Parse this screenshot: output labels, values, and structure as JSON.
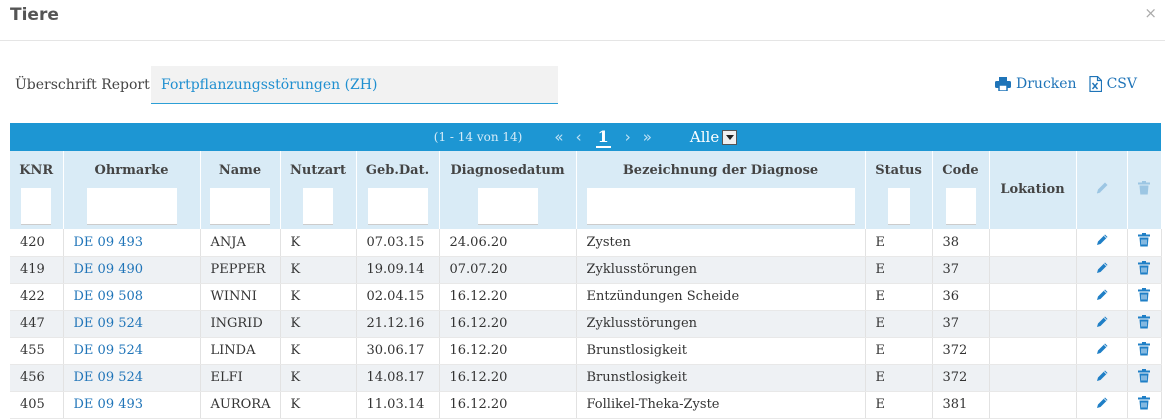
{
  "window": {
    "title": "Tiere",
    "close_glyph": "×"
  },
  "report": {
    "label": "Überschrift Report:",
    "value": "Fortpflanzungsstörungen (ZH)"
  },
  "actions": {
    "print_label": "Drucken",
    "csv_label": "CSV"
  },
  "pager": {
    "range_text": "(1 - 14 von 14)",
    "first_glyph": "«",
    "prev_glyph": "‹",
    "current_page": "1",
    "next_glyph": "›",
    "last_glyph": "»",
    "page_size": "Alle"
  },
  "columns": [
    "KNR",
    "Ohrmarke",
    "Name",
    "Nutzart",
    "Geb.Dat.",
    "Diagnosedatum",
    "Bezeichnung der Diagnose",
    "Status",
    "Code",
    "Lokation"
  ],
  "icons": {
    "edit": "pencil-icon",
    "delete": "trash-icon",
    "print": "printer-icon",
    "csv": "csv-file-icon"
  },
  "colors": {
    "accent": "#1d96d3",
    "link": "#1f74b8",
    "header_bg": "#d9ebf6"
  },
  "rows": [
    {
      "knr": "420",
      "ohrmarke": "DE 09 493",
      "name": "ANJA",
      "nutzart": "K",
      "gebdat": "07.03.15",
      "diagdat": "24.06.20",
      "bezeichnung": "Zysten",
      "status": "E",
      "code": "38",
      "lokation": ""
    },
    {
      "knr": "419",
      "ohrmarke": "DE 09 490",
      "name": "PEPPER",
      "nutzart": "K",
      "gebdat": "19.09.14",
      "diagdat": "07.07.20",
      "bezeichnung": "Zyklusstörungen",
      "status": "E",
      "code": "37",
      "lokation": ""
    },
    {
      "knr": "422",
      "ohrmarke": "DE 09 508",
      "name": "WINNI",
      "nutzart": "K",
      "gebdat": "02.04.15",
      "diagdat": "16.12.20",
      "bezeichnung": "Entzündungen Scheide",
      "status": "E",
      "code": "36",
      "lokation": ""
    },
    {
      "knr": "447",
      "ohrmarke": "DE 09 524",
      "name": "INGRID",
      "nutzart": "K",
      "gebdat": "21.12.16",
      "diagdat": "16.12.20",
      "bezeichnung": "Zyklusstörungen",
      "status": "E",
      "code": "37",
      "lokation": ""
    },
    {
      "knr": "455",
      "ohrmarke": "DE 09 524",
      "name": "LINDA",
      "nutzart": "K",
      "gebdat": "30.06.17",
      "diagdat": "16.12.20",
      "bezeichnung": "Brunstlosigkeit",
      "status": "E",
      "code": "372",
      "lokation": ""
    },
    {
      "knr": "456",
      "ohrmarke": "DE 09 524",
      "name": "ELFI",
      "nutzart": "K",
      "gebdat": "14.08.17",
      "diagdat": "16.12.20",
      "bezeichnung": "Brunstlosigkeit",
      "status": "E",
      "code": "372",
      "lokation": ""
    },
    {
      "knr": "405",
      "ohrmarke": "DE 09 493",
      "name": "AURORA",
      "nutzart": "K",
      "gebdat": "11.03.14",
      "diagdat": "16.12.20",
      "bezeichnung": "Follikel-Theka-Zyste",
      "status": "E",
      "code": "381",
      "lokation": ""
    }
  ]
}
